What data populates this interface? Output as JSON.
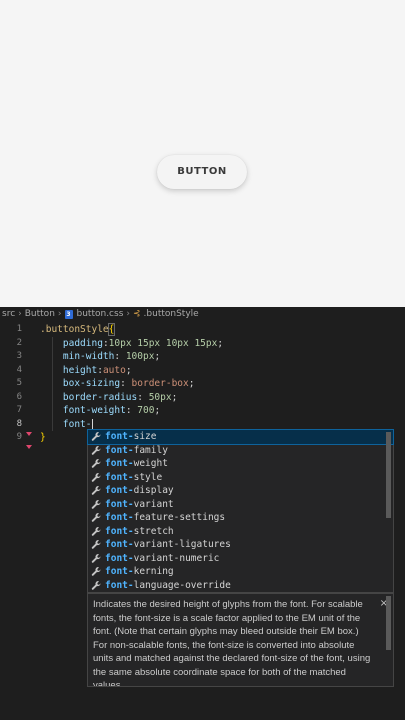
{
  "preview": {
    "button_label": "BUTTON"
  },
  "breadcrumb": {
    "folder1": "src",
    "folder2": "Button",
    "file": "button.css",
    "symbol": ".buttonStyle"
  },
  "gutter": [
    "1",
    "2",
    "3",
    "4",
    "5",
    "6",
    "7",
    "8",
    "9"
  ],
  "code": {
    "selector": ".buttonStyle",
    "open_brace": "{",
    "close_brace": "}",
    "lines": [
      {
        "prop": "padding",
        "colon": ":",
        "value": "10px 15px 10px 15px",
        "semi": ";"
      },
      {
        "prop": "min-width",
        "colon": ": ",
        "value": "100px",
        "semi": ";"
      },
      {
        "prop": "height",
        "colon": ":",
        "value": "auto",
        "semi": ";"
      },
      {
        "prop": "box-sizing",
        "colon": ": ",
        "value": "border-box",
        "semi": ";"
      },
      {
        "prop": "border-radius",
        "colon": ": ",
        "value": "50px",
        "semi": ";"
      },
      {
        "prop": "font-weight",
        "colon": ": ",
        "value": "700",
        "semi": ";"
      }
    ],
    "typing": "font-"
  },
  "suggestions": {
    "prefix": "font-",
    "items": [
      "size",
      "family",
      "weight",
      "style",
      "display",
      "variant",
      "feature-settings",
      "stretch",
      "variant-ligatures",
      "variant-numeric",
      "kerning",
      "language-override"
    ]
  },
  "docs": {
    "text": "Indicates the desired height of glyphs from the font. For scalable fonts, the font-size is a scale factor applied to the EM unit of the font. (Note that certain glyphs may bleed outside their EM box.) For non-scalable fonts, the font-size is converted into absolute units and matched against the declared font-size of the font, using the same absolute coordinate space for both of the matched values.",
    "close": "×"
  }
}
